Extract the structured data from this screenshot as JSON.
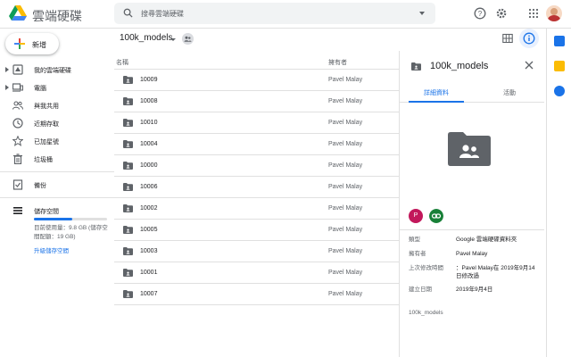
{
  "app": {
    "title": "雲端硬碟"
  },
  "search": {
    "placeholder": "搜尋雲端硬碟"
  },
  "new_button": {
    "label": "新增"
  },
  "sidebar": {
    "items": [
      {
        "label": "我的雲端硬碟",
        "icon": "drive-icon",
        "expandable": true
      },
      {
        "label": "電腦",
        "icon": "computer-icon",
        "expandable": true
      },
      {
        "label": "與我共用",
        "icon": "shared-icon",
        "expandable": false
      },
      {
        "label": "近期存取",
        "icon": "clock-icon",
        "expandable": false
      },
      {
        "label": "已加星號",
        "icon": "star-icon",
        "expandable": false
      },
      {
        "label": "垃圾桶",
        "icon": "trash-icon",
        "expandable": false
      }
    ],
    "backup_label": "備份",
    "storage_label": "儲存空間",
    "storage_text": "目前使用量：9.8 GB (儲存空間配額：19 GB)",
    "storage_fraction": 0.52,
    "upgrade_label": "升級儲存空間"
  },
  "breadcrumb": {
    "label": "100k_models"
  },
  "list": {
    "col_name": "名稱",
    "col_owner": "擁有者",
    "rows": [
      {
        "name": "10009",
        "owner": "Pavel Malay"
      },
      {
        "name": "10008",
        "owner": "Pavel Malay"
      },
      {
        "name": "10010",
        "owner": "Pavel Malay"
      },
      {
        "name": "10004",
        "owner": "Pavel Malay"
      },
      {
        "name": "10000",
        "owner": "Pavel Malay"
      },
      {
        "name": "10006",
        "owner": "Pavel Malay"
      },
      {
        "name": "10002",
        "owner": "Pavel Malay"
      },
      {
        "name": "10005",
        "owner": "Pavel Malay"
      },
      {
        "name": "10003",
        "owner": "Pavel Malay"
      },
      {
        "name": "10001",
        "owner": "Pavel Malay"
      },
      {
        "name": "10007",
        "owner": "Pavel Malay"
      }
    ]
  },
  "details": {
    "title": "100k_models",
    "tab_details": "詳細資料",
    "tab_activity": "活動",
    "badge_letter": "P",
    "meta": [
      {
        "key": "類型",
        "value": "Google 雲端硬碟資料夾"
      },
      {
        "key": "擁有者",
        "value": "Pavel Malay"
      },
      {
        "key": "上次修改時間",
        "value": "：Pavel Malay在 2019年9月14日修改過"
      },
      {
        "key": "建立日期",
        "value": "2019年9月4日"
      }
    ],
    "footer": "100k_models"
  },
  "colors": {
    "accent": "#1a73e8",
    "badge_person": "#c2185b",
    "badge_link": "#188038",
    "folder_grey": "#5f6368"
  }
}
